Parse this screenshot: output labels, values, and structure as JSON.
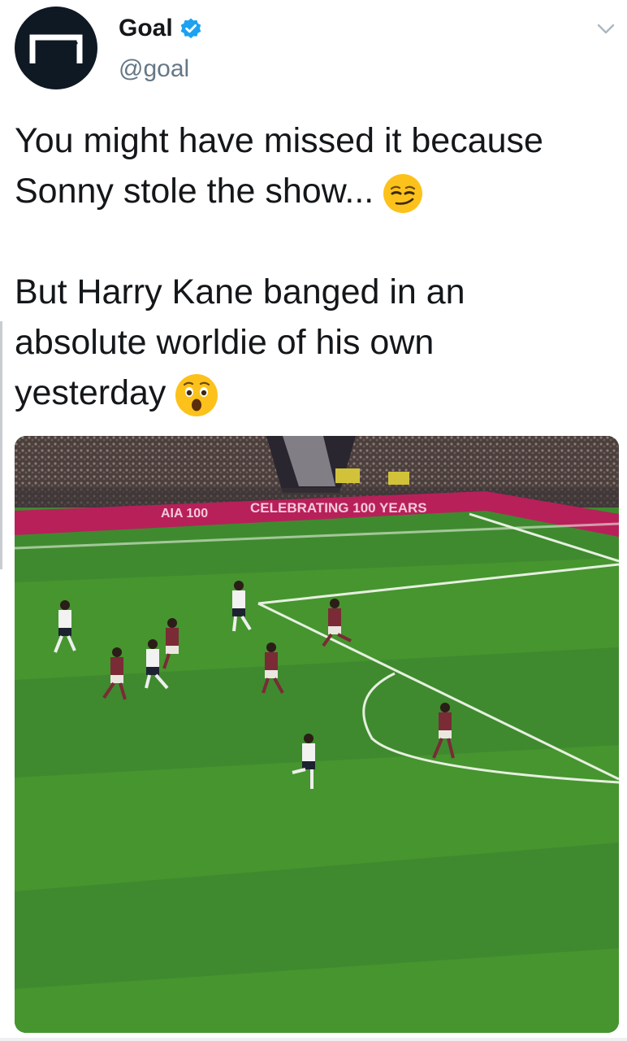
{
  "author": {
    "display_name": "Goal",
    "handle": "@goal",
    "verified": true,
    "avatar_icon": "goal-frame-logo",
    "avatar_bg": "#0f1923"
  },
  "menu_icon": "chevron-down-icon",
  "tweet": {
    "paragraph1": {
      "line1": "You might have missed it because",
      "line2": "Sonny stole the show...",
      "emoji": "smirking-face"
    },
    "paragraph2": {
      "line1": "But Harry Kane banged in an",
      "line2": "absolute worldie of his own",
      "line3": "yesterday",
      "emoji": "hushed-face"
    }
  },
  "media": {
    "type": "video-still",
    "subject": "football-pitch",
    "ad_board_text": {
      "left": "AIA 100",
      "center": "CELEBRATING 100 YEARS"
    }
  },
  "colors": {
    "verified": "#1da1f2",
    "handle": "#657786",
    "text": "#14171a",
    "pitch": "#3f8a2f",
    "ad_board": "#b8205a"
  }
}
